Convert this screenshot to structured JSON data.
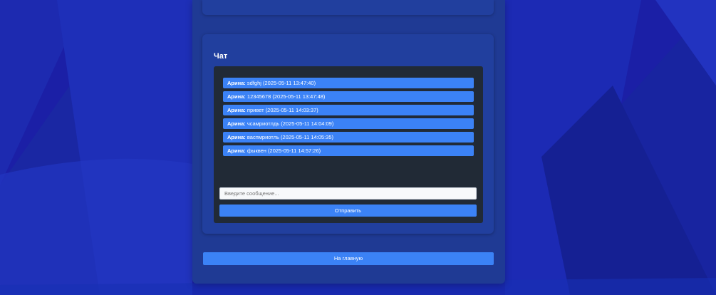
{
  "chat": {
    "title": "Чат",
    "messages": [
      {
        "author": "Арина:",
        "text": " sdfghj (2025-05-11 13:47:40)"
      },
      {
        "author": "Арина:",
        "text": " 12345678 (2025-05-11 13:47:48)"
      },
      {
        "author": "Арина:",
        "text": " привет (2025-05-11 14:03:37)"
      },
      {
        "author": "Арина:",
        "text": " чсамриотлдь (2025-05-11 14:04:09)"
      },
      {
        "author": "Арина:",
        "text": " васпмриотль (2025-05-11 14:05:35)"
      },
      {
        "author": "Арина:",
        "text": " фыквен (2025-05-11 14:57:26)"
      }
    ],
    "input_placeholder": "Введите сообщение...",
    "input_value": "",
    "send_label": "Отправить"
  },
  "home_label": "На главную",
  "colors": {
    "accent": "#3b82f6",
    "panel": "#1f3a94",
    "chat_box": "#212a36",
    "background": "#1a22a8"
  }
}
